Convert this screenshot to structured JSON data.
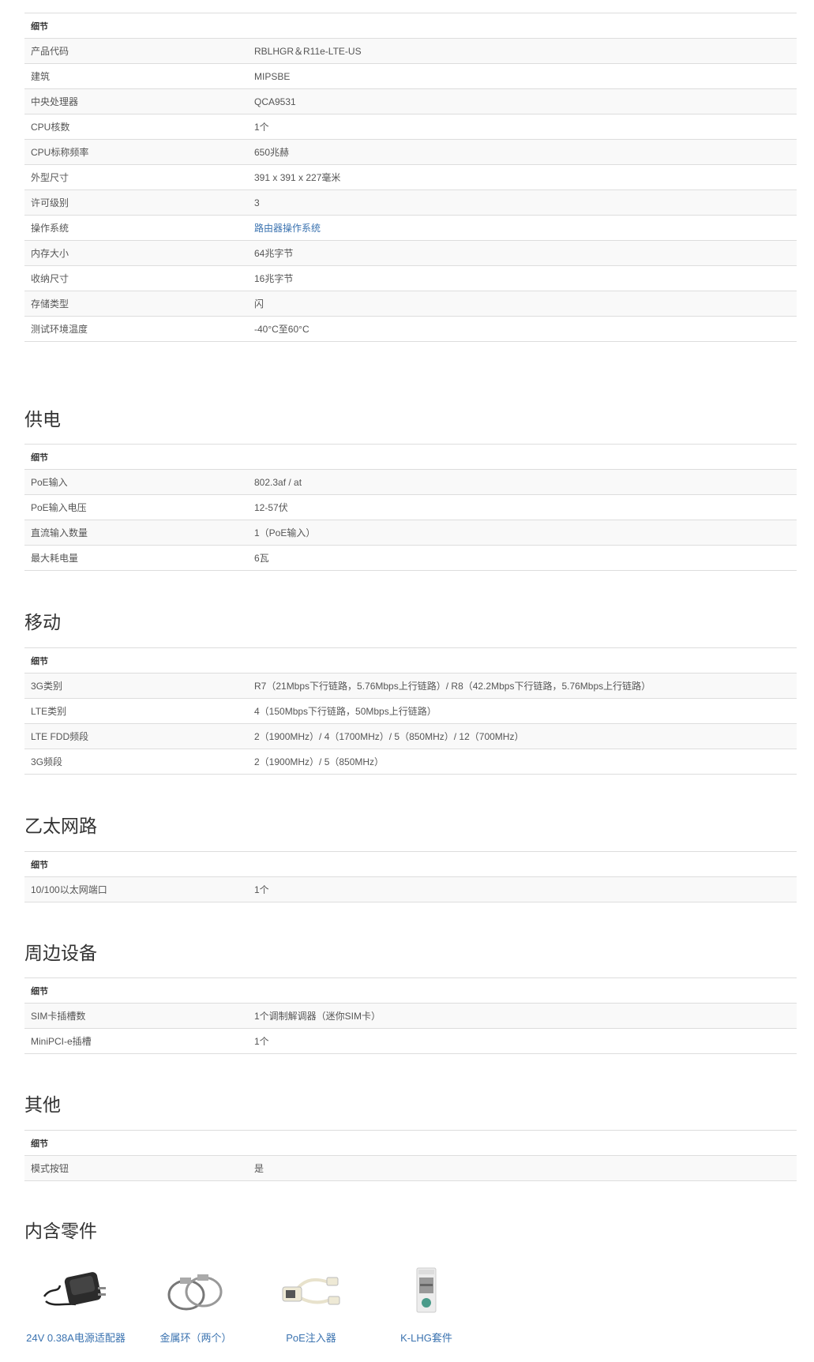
{
  "general": {
    "header": "细节",
    "rows": [
      {
        "label": "产品代码",
        "value": "RBLHGR＆R11e-LTE-US"
      },
      {
        "label": "建筑",
        "value": "MIPSBE"
      },
      {
        "label": "中央处理器",
        "value": "QCA9531"
      },
      {
        "label": "CPU核数",
        "value": "1个"
      },
      {
        "label": "CPU标称频率",
        "value": "650兆赫"
      },
      {
        "label": "外型尺寸",
        "value": "391 x 391 x 227毫米"
      },
      {
        "label": "许可级别",
        "value": "3"
      },
      {
        "label": "操作系统",
        "value": "路由器操作系统"
      },
      {
        "label": "内存大小",
        "value": "64兆字节"
      },
      {
        "label": "收纳尺寸",
        "value": "16兆字节"
      },
      {
        "label": "存储类型",
        "value": "闪"
      },
      {
        "label": "测试环境温度",
        "value": "-40°C至60°C"
      }
    ]
  },
  "power": {
    "title": "供电",
    "header": "细节",
    "rows": [
      {
        "label": "PoE输入",
        "value": "802.3af / at"
      },
      {
        "label": "PoE输入电压",
        "value": "12-57伏"
      },
      {
        "label": "直流输入数量",
        "value": "1（PoE输入）"
      },
      {
        "label": "最大耗电量",
        "value": "6瓦"
      }
    ]
  },
  "mobile": {
    "title": "移动",
    "header": "细节",
    "rows": [
      {
        "label": "3G类别",
        "value": "R7（21Mbps下行链路，5.76Mbps上行链路）/ R8（42.2Mbps下行链路，5.76Mbps上行链路）"
      },
      {
        "label": "LTE类别",
        "value": "4（150Mbps下行链路，50Mbps上行链路）"
      },
      {
        "label": "LTE FDD频段",
        "value": "2（1900MHz）/ 4（1700MHz）/ 5（850MHz）/ 12（700MHz）"
      },
      {
        "label": "3G频段",
        "value": "2（1900MHz）/ 5（850MHz）"
      }
    ]
  },
  "ethernet": {
    "title": "乙太网路",
    "header": "细节",
    "rows": [
      {
        "label": "10/100以太网端口",
        "value": "1个"
      }
    ]
  },
  "peripherals": {
    "title": "周边设备",
    "header": "细节",
    "rows": [
      {
        "label": "SIM卡插槽数",
        "value": "1个调制解调器（迷你SIM卡）"
      },
      {
        "label": "MiniPCI-e插槽",
        "value": "1个"
      }
    ]
  },
  "other": {
    "title": "其他",
    "header": "细节",
    "rows": [
      {
        "label": "模式按钮",
        "value": "是"
      }
    ]
  },
  "included": {
    "title": "内含零件",
    "items": [
      {
        "label": "24V 0.38A电源适配器",
        "icon": "power-adapter-icon"
      },
      {
        "label": "金属环（两个）",
        "icon": "metal-rings-icon"
      },
      {
        "label": "PoE注入器",
        "icon": "poe-injector-icon"
      },
      {
        "label": "K-LHG套件",
        "icon": "k-lhg-kit-icon"
      }
    ]
  },
  "colors": {
    "link": "#3b73b0",
    "border": "#dddddd",
    "stripe": "#f9f9f9"
  }
}
